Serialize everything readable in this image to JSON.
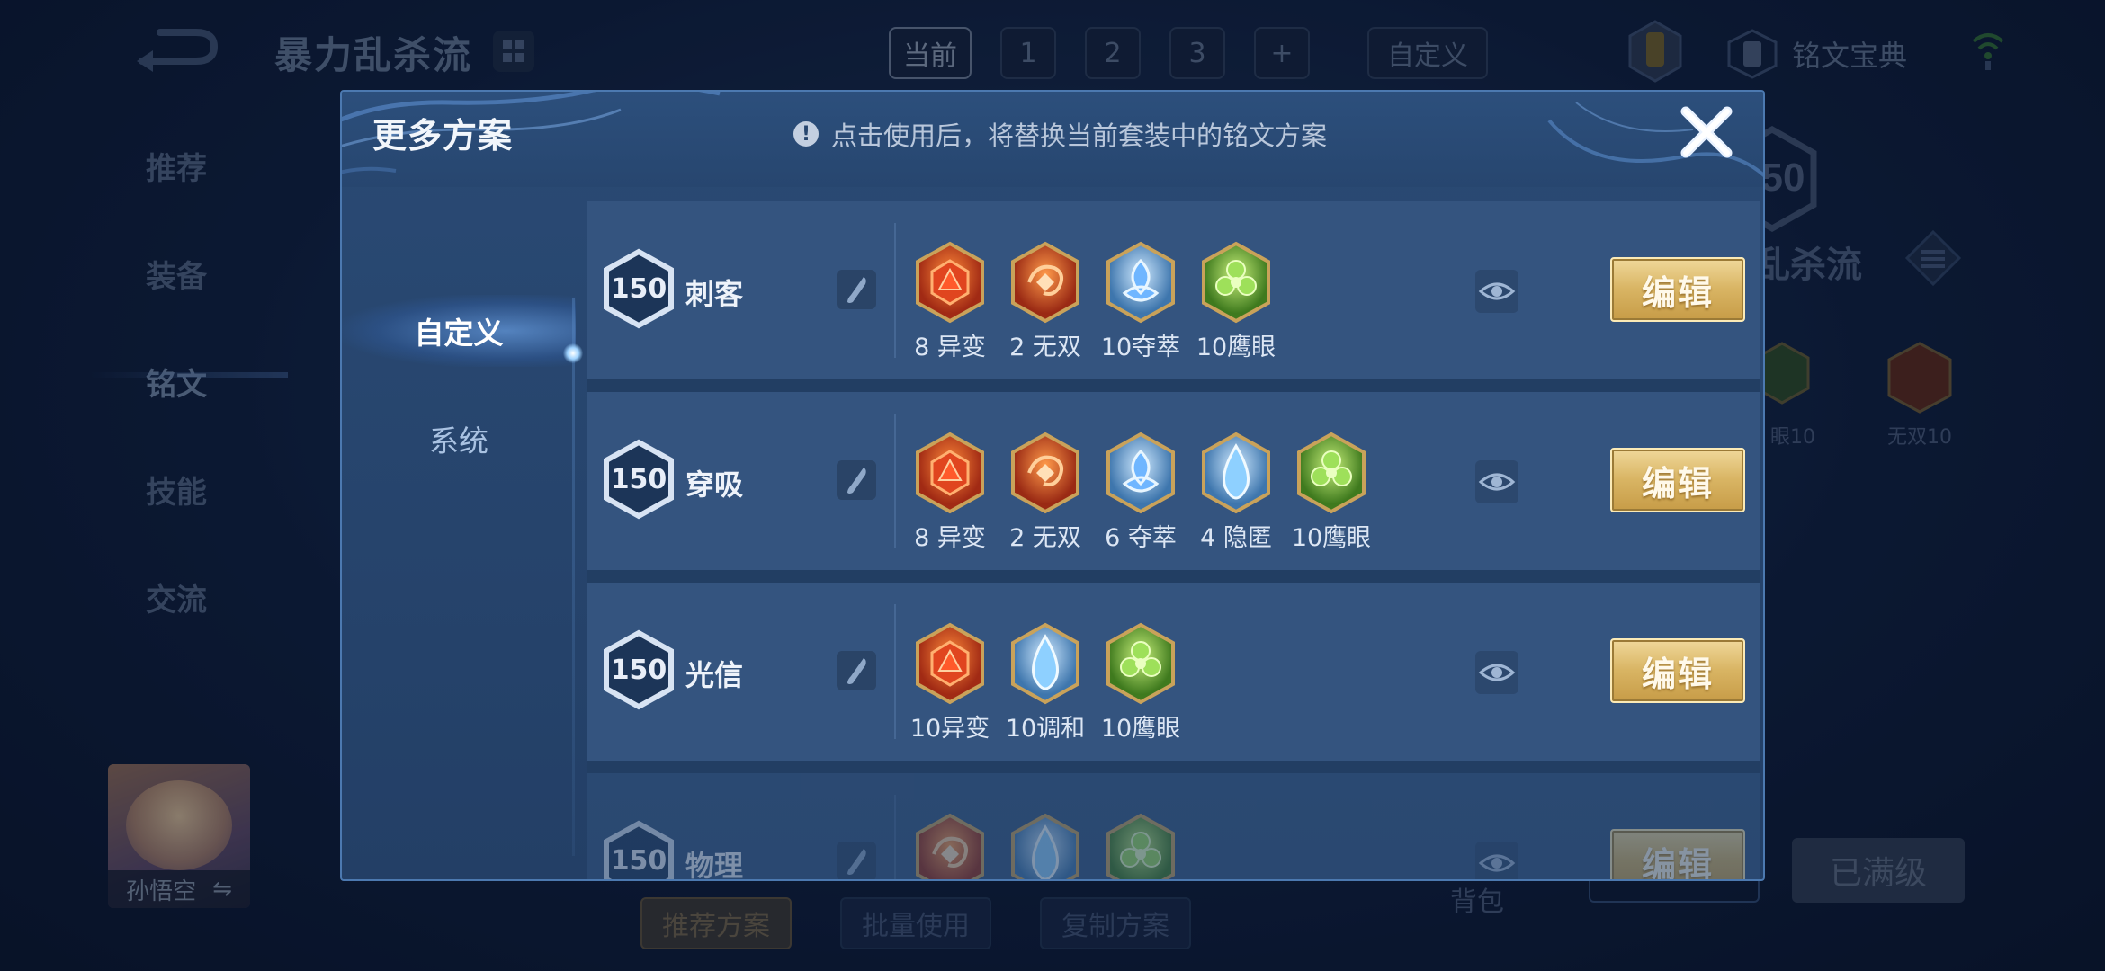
{
  "background": {
    "plan_title": "暴力乱杀流",
    "top_tabs": [
      "当前",
      "1",
      "2",
      "3",
      "+"
    ],
    "custom_tab": "自定义",
    "dictionary_label": "铭文宝典",
    "side_nav": [
      "推荐",
      "装备",
      "铭文",
      "技能",
      "交流"
    ],
    "hero_name": "孙悟空",
    "hero_switch_icon": "⇋",
    "level": "50",
    "right_plan_title": "乱杀流",
    "right_gem_labels": [
      "眼10",
      "无双10"
    ],
    "bag_label": "背包",
    "max_level_button": "已满级",
    "bottom_buttons": [
      "推荐方案",
      "批量使用",
      "复制方案"
    ]
  },
  "modal": {
    "title": "更多方案",
    "notice_icon": "!",
    "notice": "点击使用后，将替换当前套装中的铭文方案",
    "close_icon": "close-icon",
    "side_tabs": [
      "自定义",
      "系统"
    ],
    "edit_label": "编辑",
    "plans": [
      {
        "level": "150",
        "name": "刺客",
        "gems": [
          {
            "label": "8 异变",
            "kind": "red-hex"
          },
          {
            "label": "2 无双",
            "kind": "red-swirl"
          },
          {
            "label": "10夺萃",
            "kind": "blue-knot"
          },
          {
            "label": "10鹰眼",
            "kind": "green-clover"
          }
        ]
      },
      {
        "level": "150",
        "name": "穿吸",
        "gems": [
          {
            "label": "8 异变",
            "kind": "red-hex"
          },
          {
            "label": "2 无双",
            "kind": "red-swirl"
          },
          {
            "label": "6 夺萃",
            "kind": "blue-knot"
          },
          {
            "label": "4 隐匿",
            "kind": "blue-drop"
          },
          {
            "label": "10鹰眼",
            "kind": "green-clover"
          }
        ]
      },
      {
        "level": "150",
        "name": "光信",
        "gems": [
          {
            "label": "10异变",
            "kind": "red-hex"
          },
          {
            "label": "10调和",
            "kind": "blue-drop"
          },
          {
            "label": "10鹰眼",
            "kind": "green-clover"
          }
        ]
      },
      {
        "level": "150",
        "name": "物理",
        "gems": [
          {
            "label": "",
            "kind": "red-swirl"
          },
          {
            "label": "",
            "kind": "blue-drop"
          },
          {
            "label": "",
            "kind": "green-clover"
          }
        ]
      }
    ]
  }
}
